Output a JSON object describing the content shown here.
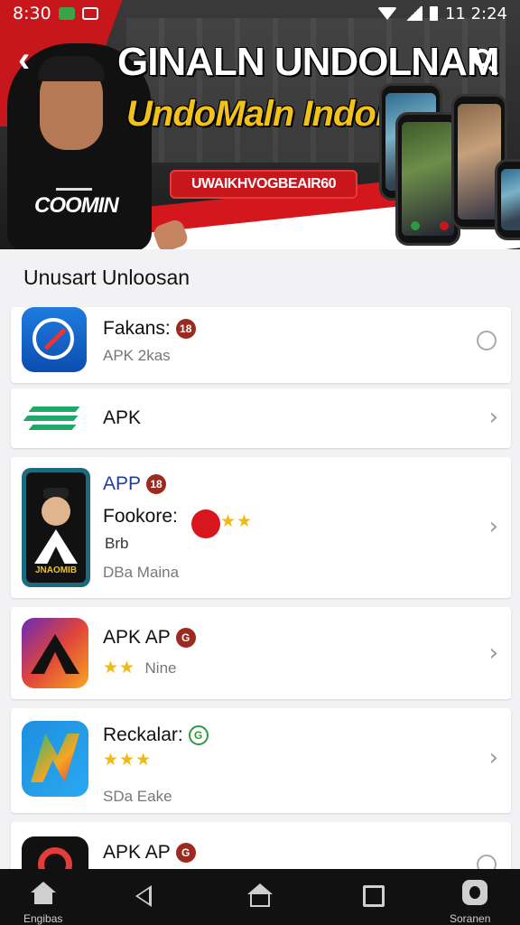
{
  "status_bar": {
    "time": "8:30",
    "right_time": "11 2:24"
  },
  "hero": {
    "title": "GINALN UNDOLNAM",
    "subtitle": "UndoMaln Indonsi!",
    "pill_text": "UWAIKHVOGBEAIR60",
    "brand": "COOMIN",
    "slides_count": 3
  },
  "section_title": "Unusart Unloosan",
  "apps": [
    {
      "name": "Fakans:",
      "badge": "18",
      "subtitle": "APK 2kas",
      "action": "radio"
    },
    {
      "name": "APK",
      "action": "chevron"
    },
    {
      "name": "APP",
      "badge": "18",
      "line2": "Fookore:",
      "rating_stars": "★★",
      "line3": "Brb",
      "subtitle": "DBa Maina",
      "action": "chevron"
    },
    {
      "name": "APK AP",
      "badge": "G",
      "rating_stars": "★★",
      "subtitle": "Nine",
      "action": "chevron"
    },
    {
      "name": "Reckalar:",
      "badge": "G",
      "rating_stars": "★★★",
      "subtitle": "SDa Eake",
      "action": "chevron"
    },
    {
      "name": "APK AP",
      "badge": "G",
      "action": "radio"
    }
  ],
  "icon_text": {
    "app3_icon": "JNAOMIB"
  },
  "nav": {
    "left_label": "Engibas",
    "right_label": "Soranen"
  },
  "colors": {
    "brand_red": "#c8161d",
    "accent_yellow": "#f2c21b",
    "badge_red": "#9c2a1e"
  }
}
